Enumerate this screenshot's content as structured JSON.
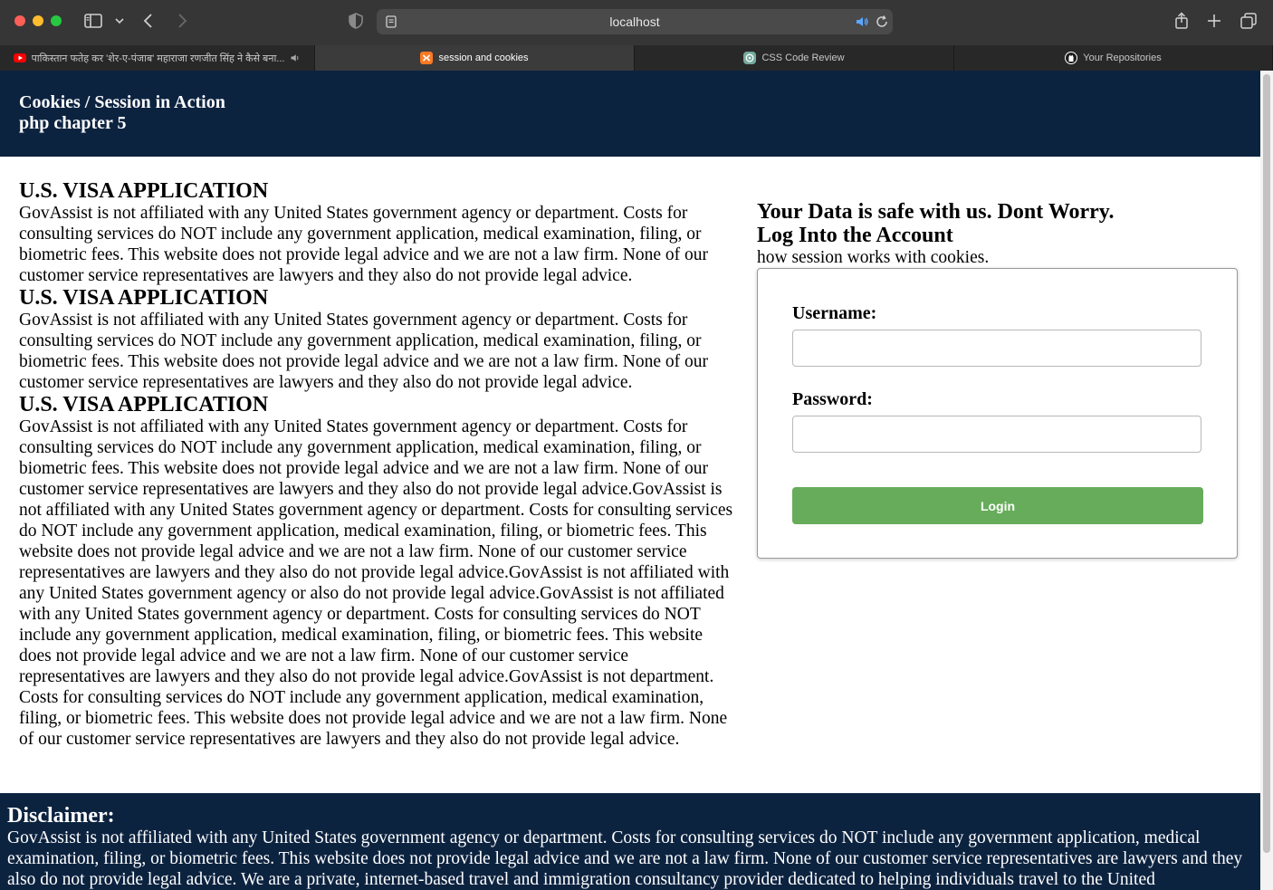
{
  "browser": {
    "url": "localhost",
    "tabs": [
      {
        "label": "पाकिस्तान फतेह कर 'शेर-ए-पंजाब' महाराजा रणजीत सिंह ने कैसे बना...",
        "active": false,
        "icon": "youtube-icon"
      },
      {
        "label": "session and cookies",
        "active": true,
        "icon": "xampp-icon"
      },
      {
        "label": "CSS Code Review",
        "active": false,
        "icon": "chatgpt-icon"
      },
      {
        "label": "Your Repositories",
        "active": false,
        "icon": "github-icon"
      }
    ]
  },
  "header": {
    "title": "Cookies / Session in Action",
    "subtitle": "php chapter 5"
  },
  "articles": [
    {
      "heading": "U.S. VISA APPLICATION",
      "text": "GovAssist is not affiliated with any United States government agency or department. Costs for consulting services do NOT include any government application, medical examination, filing, or biometric fees. This website does not provide legal advice and we are not a law firm. None of our customer service representatives are lawyers and they also do not provide legal advice."
    },
    {
      "heading": "U.S. VISA APPLICATION",
      "text": "GovAssist is not affiliated with any United States government agency or department. Costs for consulting services do NOT include any government application, medical examination, filing, or biometric fees. This website does not provide legal advice and we are not a law firm. None of our customer service representatives are lawyers and they also do not provide legal advice."
    },
    {
      "heading": "U.S. VISA APPLICATION",
      "text": "GovAssist is not affiliated with any United States government agency or department. Costs for consulting services do NOT include any government application, medical examination, filing, or biometric fees. This website does not provide legal advice and we are not a law firm. None of our customer service representatives are lawyers and they also do not provide legal advice.GovAssist is not affiliated with any United States government agency or department. Costs for consulting services do NOT include any government application, medical examination, filing, or biometric fees. This website does not provide legal advice and we are not a law firm. None of our customer service representatives are lawyers and they also do not provide legal advice.GovAssist is not affiliated with any United States government agency or also do not provide legal advice.GovAssist is not affiliated with any United States government agency or department. Costs for consulting services do NOT include any government application, medical examination, filing, or biometric fees. This website does not provide legal advice and we are not a law firm. None of our customer service representatives are lawyers and they also do not provide legal advice.GovAssist is not department. Costs for consulting services do NOT include any government application, medical examination, filing, or biometric fees. This website does not provide legal advice and we are not a law firm. None of our customer service representatives are lawyers and they also do not provide legal advice."
    }
  ],
  "sidebar": {
    "heading1": "Your Data is safe with us. Dont Worry.",
    "heading2": "Log Into the Account",
    "note": "how session works with cookies."
  },
  "login": {
    "username_label": "Username:",
    "username_value": "",
    "password_label": "Password:",
    "password_value": "",
    "button_label": "Login",
    "button_color": "#67ac5b"
  },
  "footer": {
    "title": "Disclaimer:",
    "text": "GovAssist is not affiliated with any United States government agency or department. Costs for consulting services do NOT include any government application, medical examination, filing, or biometric fees. This website does not provide legal advice and we are not a law firm. None of our customer service representatives are lawyers and they also do not provide legal advice. We are a private, internet-based travel and immigration consultancy provider dedicated to helping individuals travel to the United"
  },
  "colors": {
    "header_bg": "#0c2340",
    "footer_bg": "#0c2340"
  }
}
